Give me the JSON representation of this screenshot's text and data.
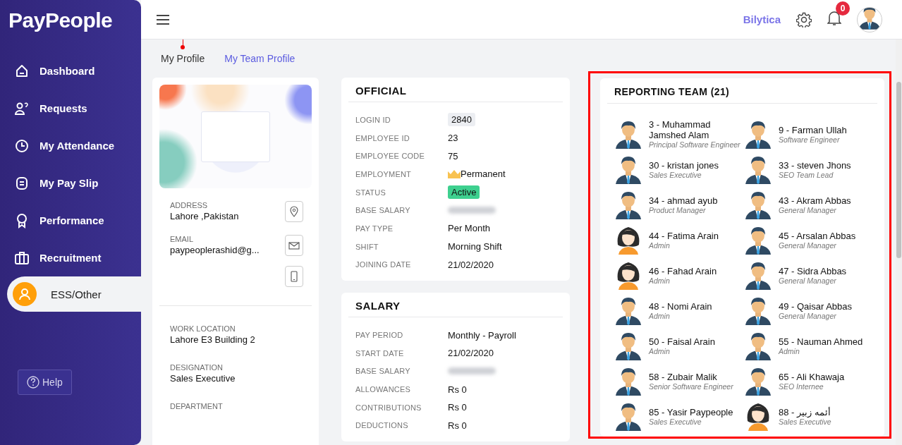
{
  "brand": {
    "logo": "PayPeople"
  },
  "sidebar": {
    "items": [
      {
        "label": "Dashboard",
        "selected": false
      },
      {
        "label": "Requests",
        "selected": false
      },
      {
        "label": "My Attendance",
        "selected": false
      },
      {
        "label": "My Pay Slip",
        "selected": false
      },
      {
        "label": "Performance",
        "selected": false
      },
      {
        "label": "Recruitment",
        "selected": false
      },
      {
        "label": "ESS/Other",
        "selected": true
      }
    ],
    "help": "Help"
  },
  "topbar": {
    "company": "Bilytica",
    "notifications": "0"
  },
  "tabs": [
    {
      "label": "My Profile",
      "selected": true
    },
    {
      "label": "My Team Profile",
      "selected": false
    }
  ],
  "profile": {
    "contacts": [
      {
        "label": "ADDRESS",
        "value": "Lahore ,Pakistan"
      },
      {
        "label": "EMAIL",
        "value": "paypeoplerashid@g..."
      }
    ],
    "details": [
      {
        "label": "WORK LOCATION",
        "value": "Lahore E3 Building 2"
      },
      {
        "label": "DESIGNATION",
        "value": "Sales Executive"
      },
      {
        "label": "DEPARTMENT"
      }
    ]
  },
  "official": {
    "title": "OFFICIAL",
    "rows": [
      {
        "label": "LOGIN ID",
        "kind": "code",
        "value": "2840"
      },
      {
        "label": "EMPLOYEE ID",
        "kind": "text",
        "value": "23"
      },
      {
        "label": "EMPLOYEE CODE",
        "kind": "text",
        "value": "75"
      },
      {
        "label": "EMPLOYMENT",
        "kind": "crown",
        "value": "Permanent"
      },
      {
        "label": "STATUS",
        "kind": "badge",
        "value": "Active"
      },
      {
        "label": "BASE SALARY",
        "kind": "blurred"
      },
      {
        "label": "PAY TYPE",
        "kind": "text",
        "value": "Per Month"
      },
      {
        "label": "SHIFT",
        "kind": "text",
        "value": "Morning Shift"
      },
      {
        "label": "JOINING DATE",
        "kind": "text",
        "value": "21/02/2020"
      }
    ]
  },
  "salary": {
    "title": "SALARY",
    "rows": [
      {
        "label": "PAY PERIOD",
        "kind": "text",
        "value": "Monthly - Payroll"
      },
      {
        "label": "START DATE",
        "kind": "text",
        "value": "21/02/2020"
      },
      {
        "label": "BASE SALARY",
        "kind": "blurred"
      },
      {
        "label": "ALLOWANCES",
        "kind": "text",
        "value": "Rs 0"
      },
      {
        "label": "CONTRIBUTIONS",
        "kind": "text",
        "value": "Rs 0"
      },
      {
        "label": "DEDUCTIONS",
        "kind": "text",
        "value": "Rs 0"
      }
    ]
  },
  "reporting_team": {
    "title": "REPORTING TEAM (21)",
    "members": [
      {
        "name": "3 - Muhammad Jamshed Alam",
        "role": "Principal Software Engineer",
        "kind": "male"
      },
      {
        "name": "9 - Farman Ullah",
        "role": "Software Engineer",
        "kind": "male"
      },
      {
        "name": "30 - kristan jones",
        "role": "Sales Executive",
        "kind": "male"
      },
      {
        "name": "33 - steven Jhons",
        "role": "SEO Team Lead",
        "kind": "male"
      },
      {
        "name": "34 - ahmad ayub",
        "role": "Product Manager",
        "kind": "male"
      },
      {
        "name": "43 - Akram Abbas",
        "role": "General Manager",
        "kind": "male"
      },
      {
        "name": "44 - Fatima Arain",
        "role": "Admin",
        "kind": "female"
      },
      {
        "name": "45 - Arsalan Abbas",
        "role": "General Manager",
        "kind": "male"
      },
      {
        "name": "46 - Fahad Arain",
        "role": "Admin",
        "kind": "female"
      },
      {
        "name": "47 - Sidra Abbas",
        "role": "General Manager",
        "kind": "male"
      },
      {
        "name": "48 - Nomi Arain",
        "role": "Admin",
        "kind": "male"
      },
      {
        "name": "49 - Qaisar Abbas",
        "role": "General Manager",
        "kind": "male"
      },
      {
        "name": "50 - Faisal Arain",
        "role": "Admin",
        "kind": "male"
      },
      {
        "name": "55 - Nauman Ahmed",
        "role": "Admin",
        "kind": "male"
      },
      {
        "name": "58 - Zubair Malik",
        "role": "Senior Software Engineer",
        "kind": "male"
      },
      {
        "name": "65 - Ali Khawaja",
        "role": "SEO Internee",
        "kind": "male"
      },
      {
        "name": "85 - Yasir Paypeople",
        "role": "Sales Executive",
        "kind": "male"
      },
      {
        "name": "88 - أئمه زبير",
        "role": "Sales Executive",
        "kind": "female"
      }
    ]
  }
}
